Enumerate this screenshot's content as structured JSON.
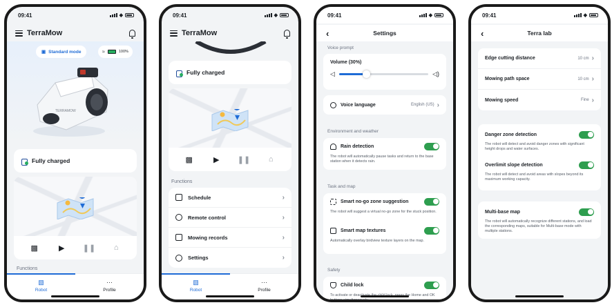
{
  "status_time": "09:41",
  "app_name": "TerraMow",
  "home": {
    "mode_label": "Standard mode",
    "battery_pct": "100%",
    "status_text": "Fully charged",
    "functions_heading": "Functions",
    "tabs": [
      {
        "label": "Robot"
      },
      {
        "label": "Profile"
      }
    ]
  },
  "functions": {
    "status_text": "Fully charged",
    "heading": "Functions",
    "items": [
      {
        "label": "Schedule"
      },
      {
        "label": "Remote control"
      },
      {
        "label": "Mowing records"
      },
      {
        "label": "Settings"
      }
    ],
    "tabs": [
      {
        "label": "Robot"
      },
      {
        "label": "Profile"
      }
    ]
  },
  "settings": {
    "title": "Settings",
    "voice_prompt_heading": "Voice prompt",
    "volume_label": "Volume (30%)",
    "volume_level": 0.3,
    "voice_language_label": "Voice language",
    "voice_language_value": "English (US)",
    "env_heading": "Environment and weather",
    "rain_label": "Rain detection",
    "rain_desc": "The robot will automatically pause tasks and return to the base station when it detects rain.",
    "task_heading": "Task and map",
    "nogo_label": "Smart no-go zone suggestion",
    "nogo_desc": "The robot will suggest a virtual no-go zone for the stuck position.",
    "textures_label": "Smart map textures",
    "textures_desc": "Automatically overlay birdview texture layers on the map.",
    "safety_heading": "Safety",
    "childlock_label": "Child lock",
    "childlock_desc": "To activate or deactivate the child lock, press the Home and OK buttons simultaneously."
  },
  "terralab": {
    "title": "Terra lab",
    "edge_label": "Edge cutting distance",
    "edge_value": "10 cm",
    "path_label": "Mowing path space",
    "path_value": "10 cm",
    "speed_label": "Mowing speed",
    "speed_value": "Fine",
    "danger_label": "Danger zone detection",
    "danger_desc": "The robot will detect and avoid danger zones with significant height drops and water surfaces.",
    "slope_label": "Overlimit slope detection",
    "slope_desc": "The robot will detect and avoid areas with slopes beyond its maximum working capacity.",
    "multibase_label": "Multi-base map",
    "multibase_desc": "The robot will automatically recognize different stations, and load the corresponding maps, suitable for Multi-base mode with multiple stations."
  },
  "colors": {
    "accent": "#1e6bd6",
    "toggle_on": "#2e9e4f",
    "background": "#f2f4f6"
  }
}
